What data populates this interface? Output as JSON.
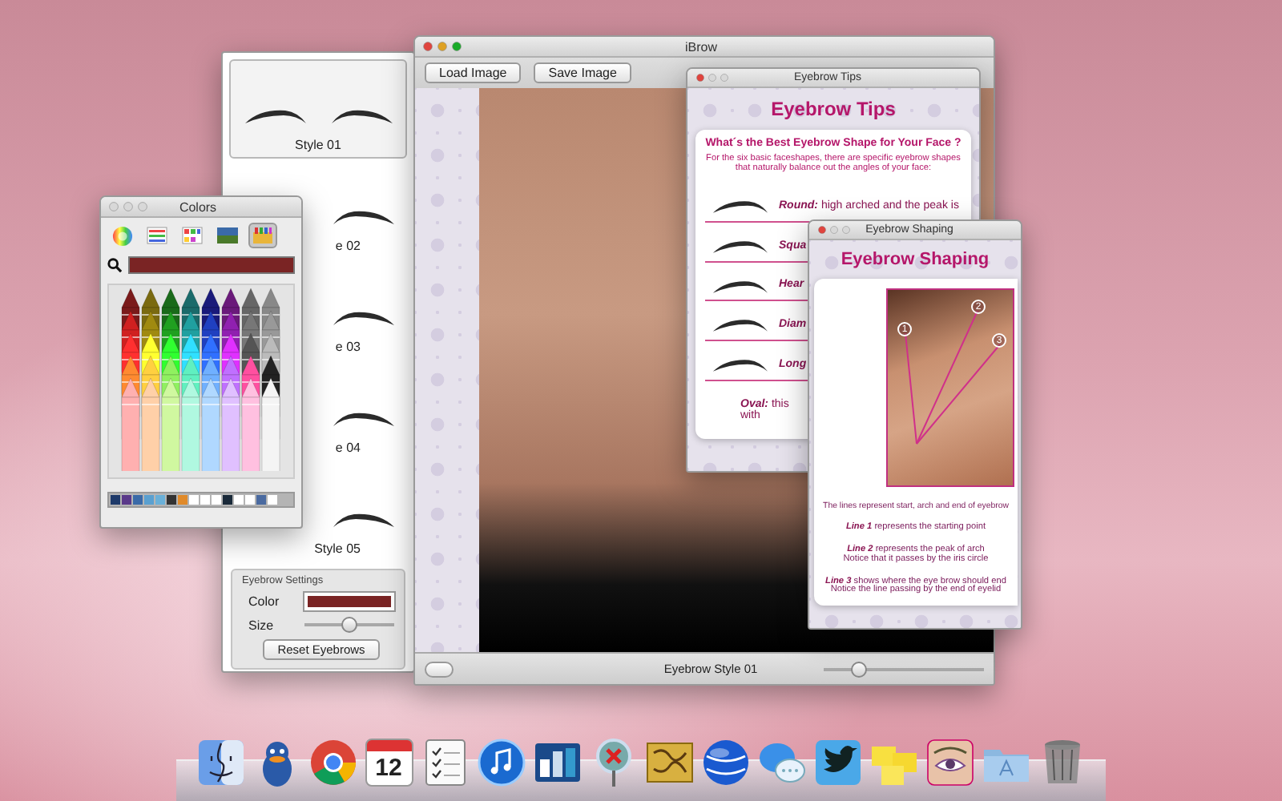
{
  "styles_panel": {
    "items": [
      {
        "label": "Style 01",
        "selected": true
      },
      {
        "label": "e 02",
        "selected": false
      },
      {
        "label": "e 03",
        "selected": false
      },
      {
        "label": "e 04",
        "selected": false
      },
      {
        "label": "Style 05",
        "selected": false
      }
    ],
    "settings": {
      "title": "Eyebrow Settings",
      "color_label": "Color",
      "color": "#7a2424",
      "size": {
        "label": "Size",
        "level": 0.5
      },
      "reset_button": "Reset Eyebrows"
    }
  },
  "main_window": {
    "title": "iBrow",
    "buttons": [
      "Load Image",
      "Save Image"
    ],
    "status": "Eyebrow Style 01",
    "zoom": {
      "level": 0.22
    }
  },
  "tips_window": {
    "title": "Eyebrow Tips",
    "heading": "Eyebrow Tips",
    "question": "What´s the Best Eyebrow Shape for Your Face ?",
    "intro": "For the six basic faceshapes, there are specific eyebrow shapes that naturally balance out the angles of your face:",
    "shapes": [
      {
        "name": "Round:",
        "text": "high arched and the peak is"
      },
      {
        "name": "Squa"
      },
      {
        "name": "Hear"
      },
      {
        "name": "Diam"
      },
      {
        "name": "Long"
      }
    ],
    "footer": {
      "name": "Oval:",
      "lines": [
        "this",
        "with"
      ]
    }
  },
  "shaping_window": {
    "title": "Eyebrow Shaping",
    "heading": "Eyebrow Shaping",
    "markers": [
      "1",
      "2",
      "3"
    ],
    "caption": "The lines represent start, arch and end of eyebrow",
    "notes": [
      {
        "name": "Line 1",
        "lines": [
          "represents the starting point"
        ]
      },
      {
        "name": "Line 2",
        "lines": [
          "represents the peak of arch",
          "Notice that it passes by the iris circle"
        ]
      },
      {
        "name": "Line 3",
        "lines": [
          "shows where the eye brow should end",
          "Notice the line passing by the end of eyelid"
        ]
      }
    ]
  },
  "colors_window": {
    "title": "Colors",
    "modes": [
      {
        "kind": "wheel",
        "selected": false
      },
      {
        "kind": "sliders",
        "selected": false
      },
      {
        "kind": "palettes",
        "selected": false
      },
      {
        "kind": "image",
        "selected": false
      },
      {
        "kind": "crayons",
        "selected": true
      }
    ],
    "current": {
      "color": "#7a2424"
    },
    "swatches": [
      {
        "color": "#1e3a6a"
      },
      {
        "color": "#5a3a8a"
      },
      {
        "color": "#3a6aa8"
      },
      {
        "color": "#5aa0d0"
      },
      {
        "color": "#6ab0d8"
      },
      {
        "color": "#333333"
      },
      {
        "color": "#e08a2a"
      },
      {
        "color": "#ffffff"
      },
      {
        "color": "#ffffff"
      },
      {
        "color": "#ffffff"
      },
      {
        "color": "#1a2a3a"
      },
      {
        "color": "#ffffff"
      },
      {
        "color": "#ffffff"
      },
      {
        "color": "#4a6aa0"
      },
      {
        "color": "#ffffff"
      }
    ]
  },
  "dock": [
    {
      "kind": "finder"
    },
    {
      "kind": "duck"
    },
    {
      "kind": "chrome"
    },
    {
      "kind": "calendar",
      "label": "12"
    },
    {
      "kind": "checklist"
    },
    {
      "kind": "music"
    },
    {
      "kind": "blocks"
    },
    {
      "kind": "pin"
    },
    {
      "kind": "map"
    },
    {
      "kind": "globe"
    },
    {
      "kind": "chat"
    },
    {
      "kind": "bird"
    },
    {
      "kind": "notes"
    },
    {
      "kind": "eye"
    },
    {
      "kind": "folder"
    },
    {
      "kind": "trash"
    }
  ]
}
